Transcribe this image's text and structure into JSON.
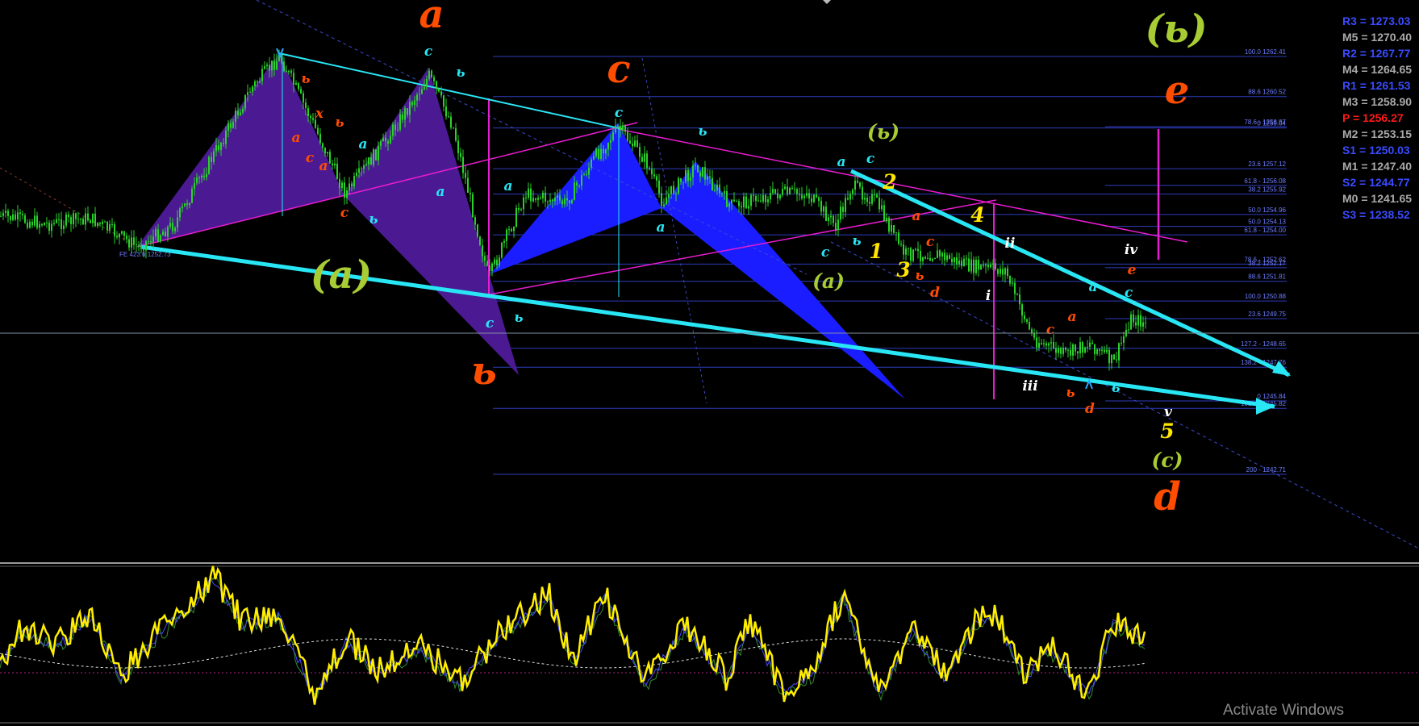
{
  "colors": {
    "background": "#000000",
    "fib_line": "#2e3dbb",
    "fib_text": "#6e7dff",
    "trend_cyan": "#29e6f5",
    "magenta": "#e81cd0",
    "purple_fill": "#4b1a92",
    "blue_fill": "#1a1dff",
    "orange": "#ff4d00",
    "olive": "#a8cc33",
    "yellow": "#ffe500",
    "candle_green": "#2bd12b",
    "oscillator": "#ffee00"
  },
  "pivots": [
    {
      "text": "R3 = 1273.03",
      "color": "#3a4bff"
    },
    {
      "text": "M5 = 1270.40",
      "color": "#a9a9a9"
    },
    {
      "text": "R2 = 1267.77",
      "color": "#3a4bff"
    },
    {
      "text": "M4 = 1264.65",
      "color": "#a9a9a9"
    },
    {
      "text": "R1 = 1261.53",
      "color": "#3a4bff"
    },
    {
      "text": "M3 = 1258.90",
      "color": "#a9a9a9"
    },
    {
      "text": "P  = 1256.27",
      "color": "#ff1a1a"
    },
    {
      "text": "M2 = 1253.15",
      "color": "#a9a9a9"
    },
    {
      "text": "S1 = 1250.03",
      "color": "#3a4bff"
    },
    {
      "text": "M1 = 1247.40",
      "color": "#a9a9a9"
    },
    {
      "text": "S2 = 1244.77",
      "color": "#3a4bff"
    },
    {
      "text": "M0 = 1241.65",
      "color": "#a9a9a9"
    },
    {
      "text": "S3 = 1238.52",
      "color": "#3a4bff"
    }
  ],
  "watermark": "Activate Windows",
  "chart_data": [
    {
      "type": "line",
      "description_kind": "price candlesticks with Fibonacci retracement levels",
      "grid": false,
      "fib_left": [
        {
          "label": "100.0 1262.41",
          "price": 1262.41
        },
        {
          "label": "88.6 1260.52",
          "price": 1260.52
        },
        {
          "label": "0 1259.04",
          "price": 1259.04
        },
        {
          "label": "23.6 1257.12",
          "price": 1257.12
        },
        {
          "label": "38.2 1255.92",
          "price": 1255.92
        },
        {
          "label": "50.0 1254.96",
          "price": 1254.96
        },
        {
          "label": "61.8 - 1254.00",
          "price": 1254.0
        },
        {
          "label": "78.6 - 1252.62",
          "price": 1252.62
        },
        {
          "label": "88.6 1251.81",
          "price": 1251.81
        },
        {
          "label": "100.0 1250.88",
          "price": 1250.88
        },
        {
          "label": "127.2 - 1248.65",
          "price": 1248.65
        },
        {
          "label": "138.2 - 1247.76",
          "price": 1247.76
        },
        {
          "label": "161.8 - 1245.82",
          "price": 1245.82
        },
        {
          "label": "200 - 1242.71",
          "price": 1242.71
        }
      ],
      "fib_right": [
        {
          "label": "78.6 - 1258.87",
          "price": 1258.87
        },
        {
          "label": "61.8 - 1256.08",
          "price": 1256.08
        },
        {
          "label": "50.0 1254.13",
          "price": 1254.13
        },
        {
          "label": "38.2 1252.17",
          "price": 1252.17
        },
        {
          "label": "23.6 1249.75",
          "price": 1249.75
        },
        {
          "label": "0 1245.84",
          "price": 1245.84
        }
      ],
      "extension_label": "FE 423.6 1252.73",
      "wave_labels": [
        {
          "text": "a",
          "color": "#ff4d00",
          "size": "xl"
        },
        {
          "text": "ь",
          "color": "#ff4d00",
          "size": "xl"
        },
        {
          "text": "c",
          "color": "#ff4d00",
          "size": "xl"
        },
        {
          "text": "d",
          "color": "#ff4d00",
          "size": "xl"
        },
        {
          "text": "e",
          "color": "#ff4d00",
          "size": "xl"
        },
        {
          "text": "(a)",
          "color": "#a8cc33",
          "size": "xl"
        },
        {
          "text": "(ь)",
          "color": "#a8cc33",
          "size": "xl"
        },
        {
          "text": "(ь)",
          "color": "#a8cc33",
          "size": "m"
        },
        {
          "text": "(a)",
          "color": "#a8cc33",
          "size": "m"
        },
        {
          "text": "(c)",
          "color": "#a8cc33",
          "size": "m"
        },
        {
          "text": "1",
          "color": "#ffe500",
          "size": "m"
        },
        {
          "text": "2",
          "color": "#ffe500",
          "size": "m"
        },
        {
          "text": "3",
          "color": "#ffe500",
          "size": "m"
        },
        {
          "text": "4",
          "color": "#ffe500",
          "size": "m"
        },
        {
          "text": "5",
          "color": "#ffe500",
          "size": "m"
        },
        {
          "text": "i",
          "color": "#ffffff",
          "size": "s"
        },
        {
          "text": "ii",
          "color": "#ffffff",
          "size": "s"
        },
        {
          "text": "iii",
          "color": "#ffffff",
          "size": "s"
        },
        {
          "text": "iv",
          "color": "#ffffff",
          "size": "s"
        },
        {
          "text": "v",
          "color": "#ffffff",
          "size": "s"
        },
        {
          "text": "ь",
          "color": "#ff4d00",
          "size": "s"
        },
        {
          "text": "a",
          "color": "#ff4d00",
          "size": "s"
        },
        {
          "text": "x",
          "color": "#ff4d00",
          "size": "s"
        },
        {
          "text": "ь",
          "color": "#ff4d00",
          "size": "s"
        },
        {
          "text": "c",
          "color": "#ff4d00",
          "size": "s"
        },
        {
          "text": "a",
          "color": "#ff4d00",
          "size": "s"
        },
        {
          "text": "c",
          "color": "#ff4d00",
          "size": "s"
        },
        {
          "text": "a",
          "color": "#29e6f5",
          "size": "s"
        },
        {
          "text": "ь",
          "color": "#29e6f5",
          "size": "s"
        },
        {
          "text": "c",
          "color": "#29e6f5",
          "size": "s"
        },
        {
          "text": "ь",
          "color": "#29e6f5",
          "size": "s"
        },
        {
          "text": "a",
          "color": "#29e6f5",
          "size": "s"
        },
        {
          "text": "c",
          "color": "#29e6f5",
          "size": "s"
        },
        {
          "text": "ь",
          "color": "#29e6f5",
          "size": "s"
        },
        {
          "text": "a",
          "color": "#29e6f5",
          "size": "s"
        },
        {
          "text": "c",
          "color": "#29e6f5",
          "size": "s"
        },
        {
          "text": "ь",
          "color": "#29e6f5",
          "size": "s"
        },
        {
          "text": "a",
          "color": "#29e6f5",
          "size": "s"
        },
        {
          "text": "a",
          "color": "#29e6f5",
          "size": "s"
        },
        {
          "text": "c",
          "color": "#29e6f5",
          "size": "s"
        },
        {
          "text": "c",
          "color": "#29e6f5",
          "size": "s"
        },
        {
          "text": "ь",
          "color": "#29e6f5",
          "size": "s"
        },
        {
          "text": "a",
          "color": "#ff4d00",
          "size": "s"
        },
        {
          "text": "c",
          "color": "#ff4d00",
          "size": "s"
        },
        {
          "text": "ь",
          "color": "#ff4d00",
          "size": "s"
        },
        {
          "text": "d",
          "color": "#ff4d00",
          "size": "s"
        },
        {
          "text": "a",
          "color": "#ff4d00",
          "size": "s"
        },
        {
          "text": "c",
          "color": "#ff4d00",
          "size": "s"
        },
        {
          "text": "ь",
          "color": "#ff4d00",
          "size": "s"
        },
        {
          "text": "d",
          "color": "#ff4d00",
          "size": "s"
        },
        {
          "text": "e",
          "color": "#ff4d00",
          "size": "s"
        },
        {
          "text": "a",
          "color": "#29e6f5",
          "size": "s"
        },
        {
          "text": "c",
          "color": "#29e6f5",
          "size": "s"
        },
        {
          "text": "ь",
          "color": "#29e6f5",
          "size": "s"
        },
        {
          "text": "ь",
          "color": "#29e6f5",
          "size": "s"
        }
      ]
    },
    {
      "type": "line",
      "description_kind": "oscillator sub-window",
      "grid": false
    }
  ]
}
